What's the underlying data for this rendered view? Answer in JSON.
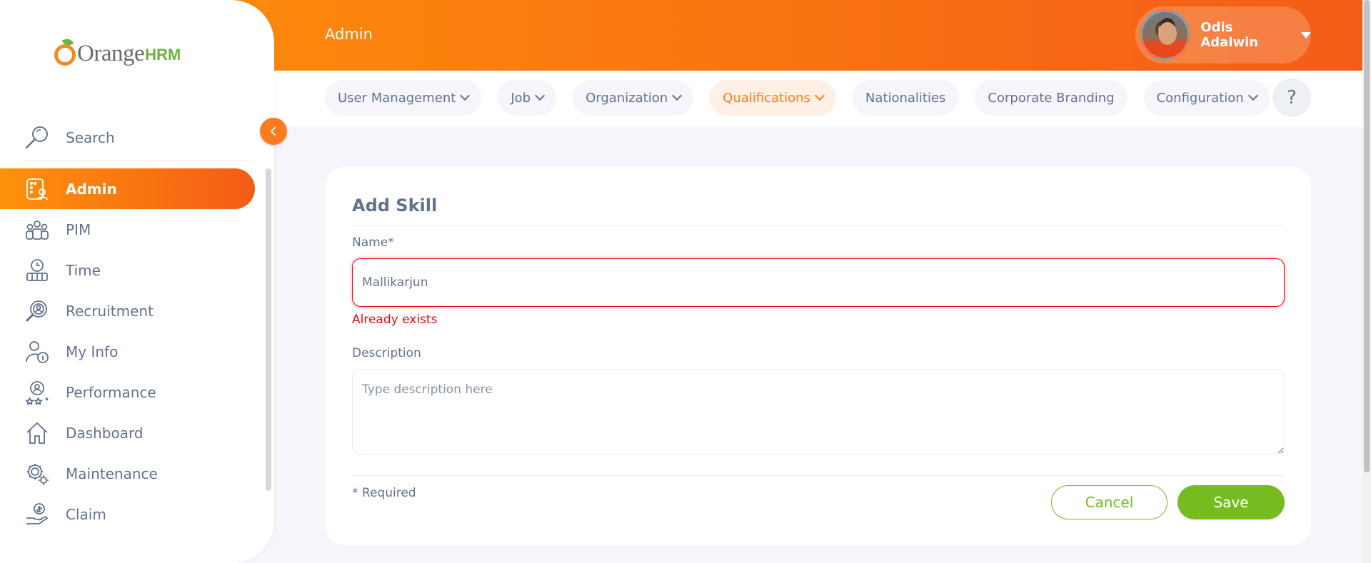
{
  "brand": {
    "name": "Orange",
    "suffix": "HRM"
  },
  "sidebar": {
    "search_label": "Search",
    "items": [
      {
        "label": "Admin",
        "icon": "admin-icon",
        "active": true
      },
      {
        "label": "PIM",
        "icon": "pim-icon"
      },
      {
        "label": "Time",
        "icon": "time-icon"
      },
      {
        "label": "Recruitment",
        "icon": "recruitment-icon"
      },
      {
        "label": "My Info",
        "icon": "my-info-icon"
      },
      {
        "label": "Performance",
        "icon": "performance-icon"
      },
      {
        "label": "Dashboard",
        "icon": "dashboard-icon"
      },
      {
        "label": "Maintenance",
        "icon": "maintenance-icon"
      },
      {
        "label": "Claim",
        "icon": "claim-icon"
      }
    ]
  },
  "header": {
    "title": "Admin",
    "user_name": "Odis Adalwin"
  },
  "tabs": [
    {
      "label": "User Management",
      "dropdown": true
    },
    {
      "label": "Job",
      "dropdown": true
    },
    {
      "label": "Organization",
      "dropdown": true
    },
    {
      "label": "Qualifications",
      "dropdown": true,
      "active": true
    },
    {
      "label": "Nationalities",
      "dropdown": false
    },
    {
      "label": "Corporate Branding",
      "dropdown": false
    },
    {
      "label": "Configuration",
      "dropdown": true
    }
  ],
  "help_label": "?",
  "form": {
    "title": "Add Skill",
    "name_label": "Name*",
    "name_value": "Mallikarjun",
    "name_error": "Already exists",
    "description_label": "Description",
    "description_placeholder": "Type description here",
    "required_note": "* Required",
    "cancel_label": "Cancel",
    "save_label": "Save"
  },
  "colors": {
    "brand_orange": "#ff7b1d",
    "gradient_start": "#ff920b",
    "gradient_end": "#f35c17",
    "success_green": "#76bc21",
    "error_red": "#eb0910",
    "text": "#64728c"
  }
}
